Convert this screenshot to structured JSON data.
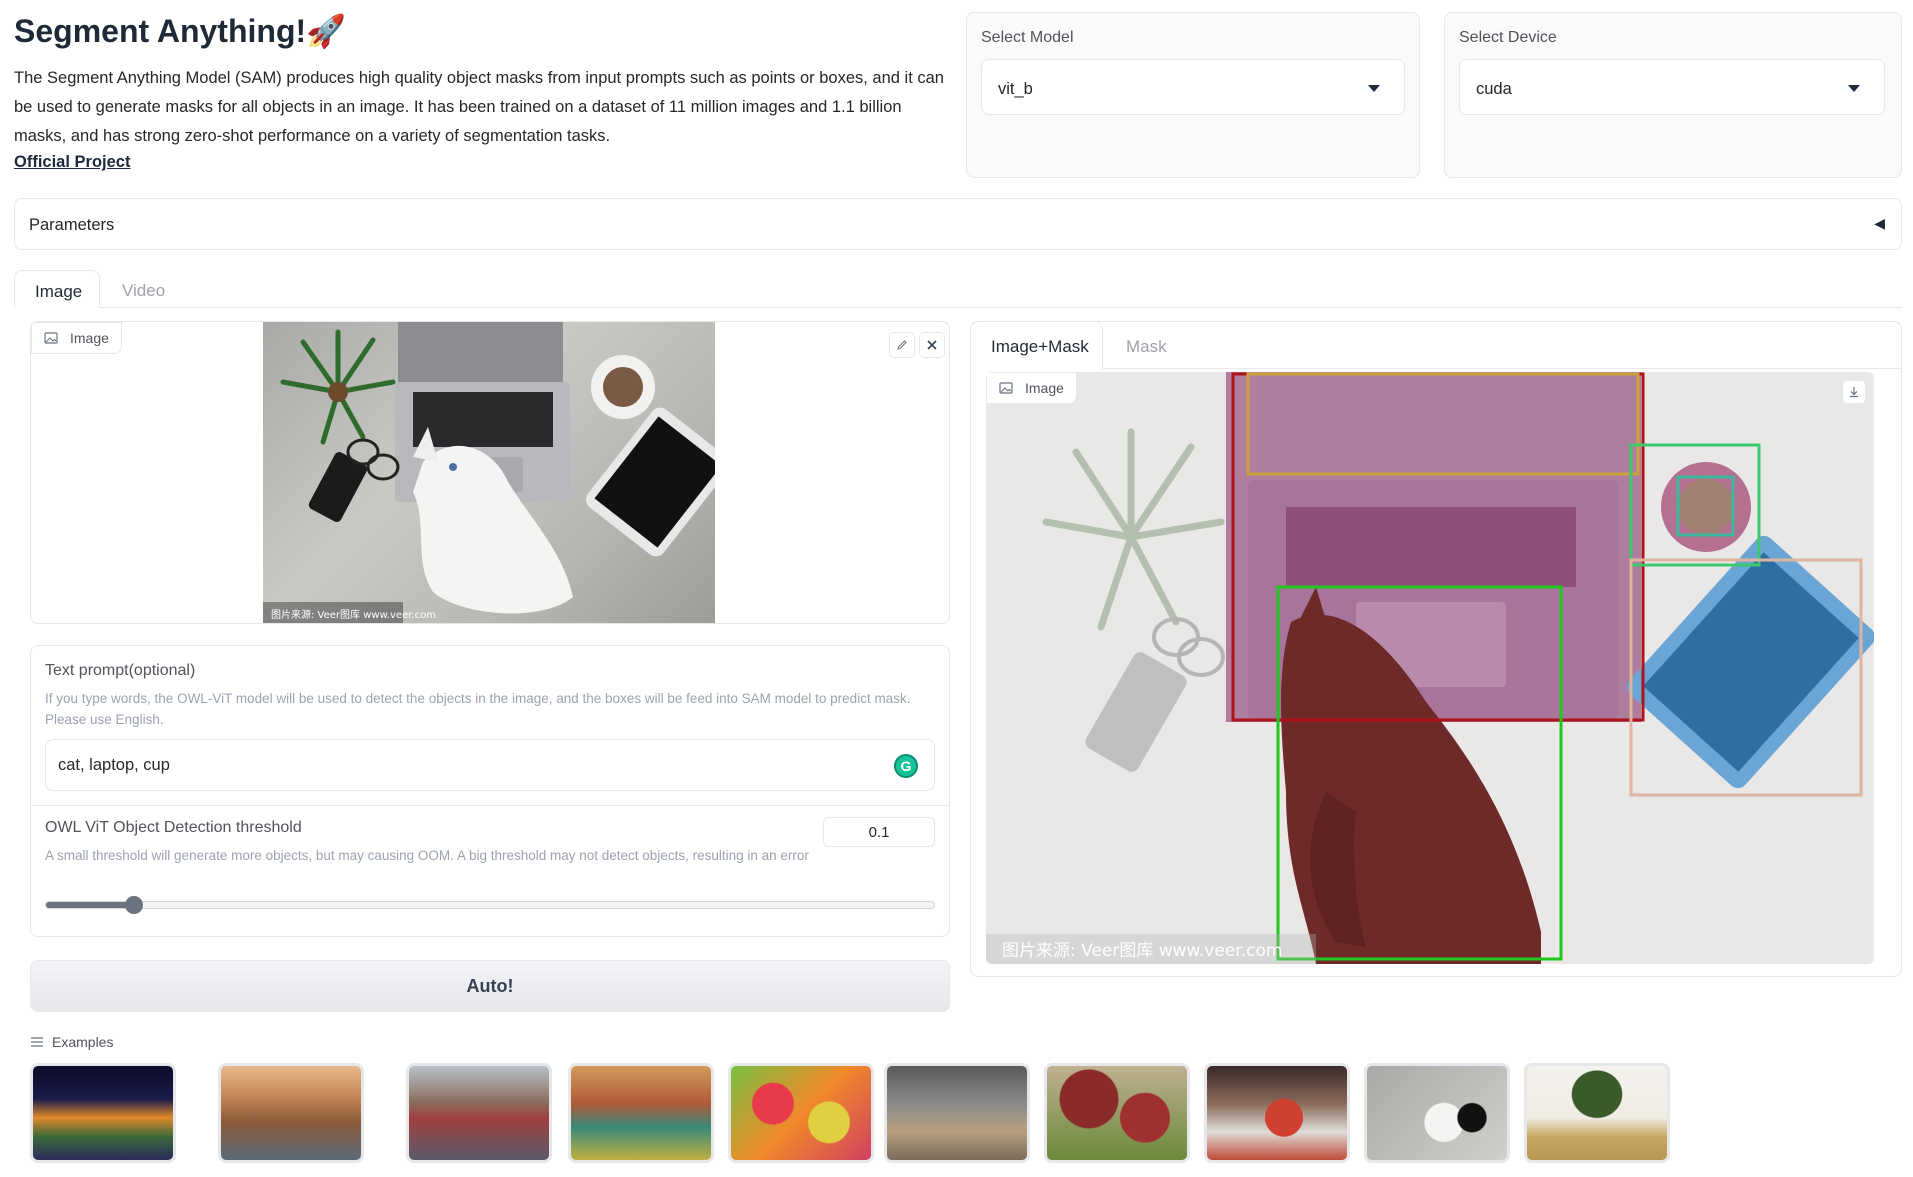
{
  "header": {
    "title": "Segment Anything!",
    "title_emoji": "🚀",
    "description": "The Segment Anything Model (SAM) produces high quality object masks from input prompts such as points or boxes, and it can be used to generate masks for all objects in an image. It has been trained on a dataset of 11 million images and 1.1 billion masks, and has strong zero-shot performance on a variety of segmentation tasks.",
    "link_label": "Official Project"
  },
  "model_select": {
    "label": "Select Model",
    "value": "vit_b"
  },
  "device_select": {
    "label": "Select Device",
    "value": "cuda"
  },
  "parameters": {
    "label": "Parameters",
    "toggle_icon": "◀"
  },
  "main_tabs": [
    {
      "label": "Image",
      "active": true
    },
    {
      "label": "Video",
      "active": false
    }
  ],
  "input_image": {
    "chip_label": "Image",
    "watermark": "图片来源: Veer图库 www.veer.com",
    "edit_icon": "pencil-icon",
    "clear_icon": "close-icon"
  },
  "text_prompt": {
    "label": "Text prompt(optional)",
    "info": "If you type words, the OWL-ViT model will be used to detect the objects in the image, and the boxes will be feed into SAM model to predict mask. Please use English.",
    "value": "cat, laptop, cup"
  },
  "threshold": {
    "label": "OWL ViT Object Detection threshold",
    "info": "A small threshold will generate more objects, but may causing OOM. A big threshold may not detect objects, resulting in an error",
    "value": "0.1",
    "fraction": 0.1
  },
  "auto_button": {
    "label": "Auto!"
  },
  "output_tabs": [
    {
      "label": "Image+Mask",
      "active": true
    },
    {
      "label": "Mask",
      "active": false
    }
  ],
  "output_image": {
    "chip_label": "Image",
    "watermark": "图片来源: Veer图库 www.veer.com",
    "download_icon": "download-icon"
  },
  "examples": {
    "label": "Examples",
    "items": [
      "night-city-street",
      "city-skyline",
      "busy-street",
      "market-square",
      "fruit-pile",
      "pipes-tunnel",
      "beans-bowls",
      "hotpot-table",
      "cat-laptop-desk",
      "giraffe-savanna"
    ]
  },
  "colors": {
    "accent": "#f97316",
    "mask_cat": "#6e2a28",
    "mask_laptop": "#9b5a85",
    "mask_tablet": "#3a7fb5",
    "box_red": "#b0121b",
    "box_green": "#1ec81e",
    "box_gold": "#c8a23c",
    "box_teal": "#3cc86e",
    "box_peach": "#e0b4a0"
  }
}
